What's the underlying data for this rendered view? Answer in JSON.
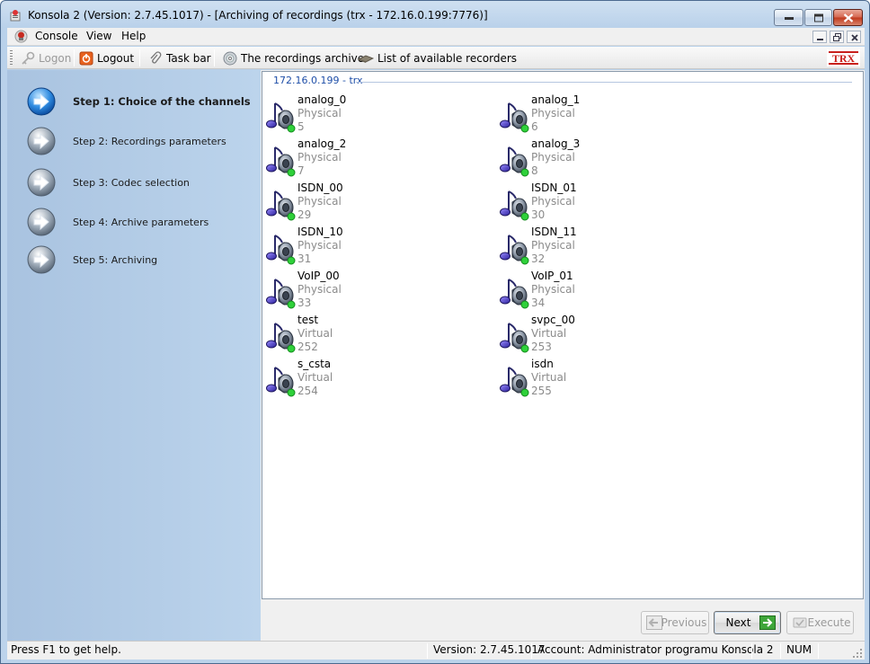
{
  "window": {
    "title": "Konsola 2 (Version:  2.7.45.1017) - [Archiving of recordings (trx - 172.16.0.199:7776)]"
  },
  "menu": {
    "console": "Console",
    "view": "View",
    "help": "Help"
  },
  "toolbar": {
    "logon": "Logon",
    "logout": "Logout",
    "task_bar": "Task bar",
    "recordings_archive": "The recordings archive",
    "recorders_list": "List of available recorders",
    "brand": "TRX"
  },
  "wizard": {
    "steps": [
      {
        "label": "Step 1: Choice of the channels",
        "active": true
      },
      {
        "label": "Step 2: Recordings parameters",
        "active": false
      },
      {
        "label": "Step 3: Codec selection",
        "active": false
      },
      {
        "label": "Step 4: Archive parameters",
        "active": false
      },
      {
        "label": "Step 5: Archiving",
        "active": false
      }
    ]
  },
  "channels": {
    "group_title": "172.16.0.199 - trx",
    "items": [
      {
        "name": "analog_0",
        "type": "Physical",
        "id": "5"
      },
      {
        "name": "analog_1",
        "type": "Physical",
        "id": "6"
      },
      {
        "name": "analog_2",
        "type": "Physical",
        "id": "7"
      },
      {
        "name": "analog_3",
        "type": "Physical",
        "id": "8"
      },
      {
        "name": "ISDN_00",
        "type": "Physical",
        "id": "29"
      },
      {
        "name": "ISDN_01",
        "type": "Physical",
        "id": "30"
      },
      {
        "name": "ISDN_10",
        "type": "Physical",
        "id": "31"
      },
      {
        "name": "ISDN_11",
        "type": "Physical",
        "id": "32"
      },
      {
        "name": "VoIP_00",
        "type": "Physical",
        "id": "33"
      },
      {
        "name": "VoIP_01",
        "type": "Physical",
        "id": "34"
      },
      {
        "name": "test",
        "type": "Virtual",
        "id": "252"
      },
      {
        "name": "svpc_00",
        "type": "Virtual",
        "id": "253"
      },
      {
        "name": "s_csta",
        "type": "Virtual",
        "id": "254"
      },
      {
        "name": "isdn",
        "type": "Virtual",
        "id": "255"
      }
    ]
  },
  "buttons": {
    "previous": "Previous",
    "next": "Next",
    "execute": "Execute"
  },
  "statusbar": {
    "help": "Press F1 to get help.",
    "version": "Version: 2.7.45.1017",
    "account": "Account: Administrator programu Konsola 2",
    "num": "NUM"
  }
}
